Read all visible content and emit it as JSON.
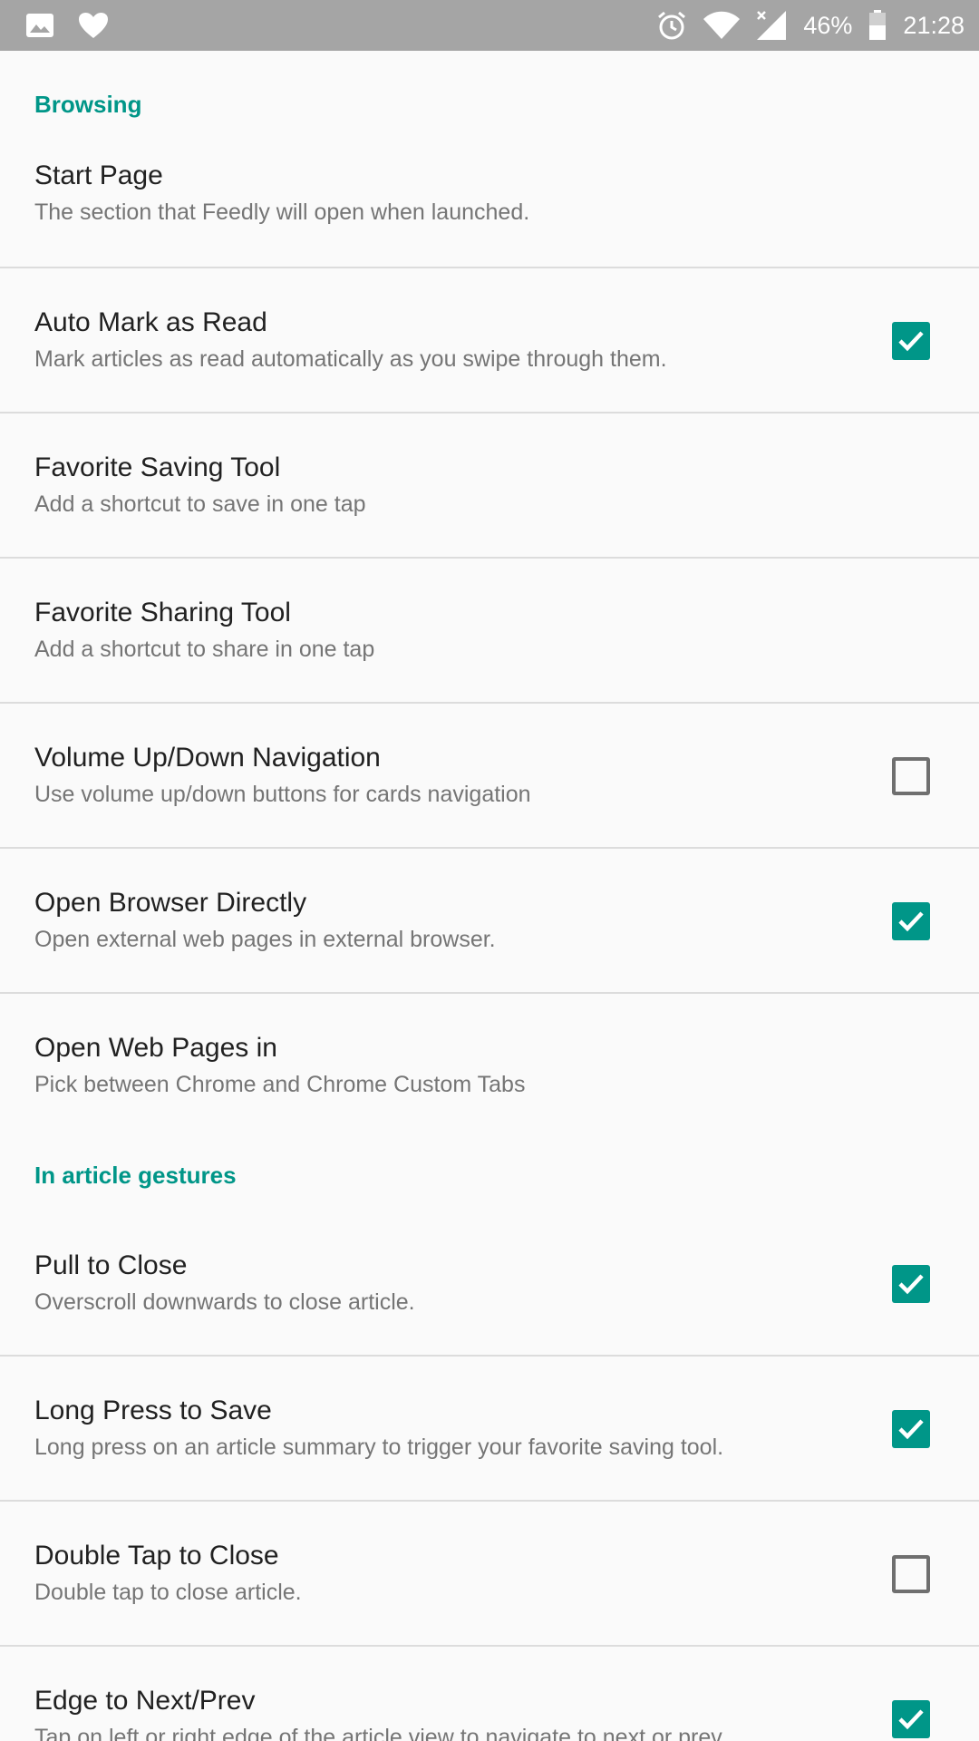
{
  "status_bar": {
    "battery_percent": "46%",
    "time": "21:28",
    "icons": [
      "image-icon",
      "heart-icon",
      "alarm-icon",
      "wifi-icon",
      "signal-icon",
      "battery-icon"
    ]
  },
  "colors": {
    "accent": "#009688",
    "status_bar": "#a5a5a5",
    "background": "#fafafa"
  },
  "sections": [
    {
      "header": "Browsing",
      "items": [
        {
          "title": "Start Page",
          "summary": "The section that Feedly will open when launched."
        },
        {
          "title": "Auto Mark as Read",
          "summary": "Mark articles as read automatically as you swipe through them.",
          "checked": true
        },
        {
          "title": "Favorite Saving Tool",
          "summary": "Add a shortcut to save in one tap"
        },
        {
          "title": "Favorite Sharing Tool",
          "summary": "Add a shortcut to share in one tap"
        },
        {
          "title": "Volume Up/Down Navigation",
          "summary": "Use volume up/down buttons for cards navigation",
          "checked": false
        },
        {
          "title": "Open Browser Directly",
          "summary": "Open external web pages in external browser.",
          "checked": true
        },
        {
          "title": "Open Web Pages in",
          "summary": "Pick between Chrome and Chrome Custom Tabs"
        }
      ]
    },
    {
      "header": "In article gestures",
      "items": [
        {
          "title": "Pull to Close",
          "summary": "Overscroll downwards to close article.",
          "checked": true
        },
        {
          "title": "Long Press to Save",
          "summary": "Long press on an article summary to trigger your favorite saving tool.",
          "checked": true
        },
        {
          "title": "Double Tap to Close",
          "summary": "Double tap to close article.",
          "checked": false
        },
        {
          "title": "Edge to Next/Prev",
          "summary": "Tap on left or right edge of the article view to navigate to next or prev",
          "checked": true
        }
      ]
    }
  ]
}
